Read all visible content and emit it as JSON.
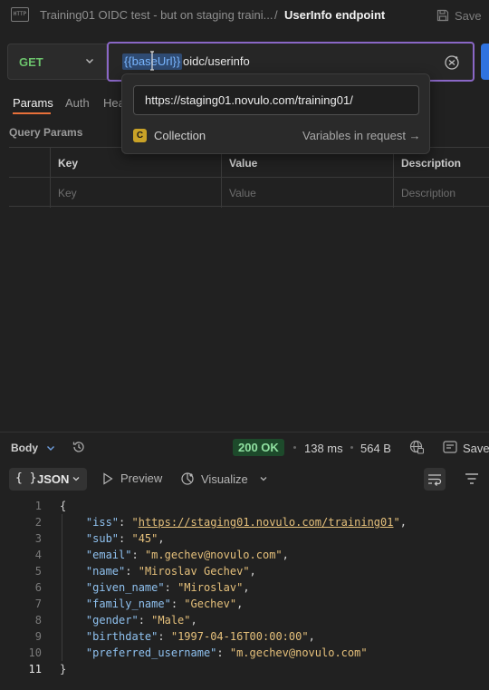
{
  "header": {
    "http_badge": "HTTP",
    "breadcrumb_parent": "Training01 OIDC test - but on staging traini...",
    "breadcrumb_separator": "/",
    "title": "UserInfo endpoint",
    "save_label": "Save"
  },
  "request": {
    "method": "GET",
    "url_variable": "{{baseUrl}}",
    "url_path": "oidc/userinfo"
  },
  "tabs": [
    {
      "label": "Params",
      "active": true
    },
    {
      "label": "Auth",
      "active": false
    },
    {
      "label": "Hea",
      "active": false
    }
  ],
  "query_params": {
    "title": "Query Params",
    "columns": [
      "Key",
      "Value",
      "Description"
    ],
    "placeholders": [
      "Key",
      "Value",
      "Description"
    ]
  },
  "variable_popover": {
    "value": "https://staging01.novulo.com/training01/",
    "scope_badge": "C",
    "scope_label": "Collection",
    "link_label": "Variables in request →"
  },
  "response": {
    "body_label": "Body",
    "status": "200 OK",
    "time": "138 ms",
    "size": "564 B",
    "save_label": "Save",
    "format": "JSON",
    "format_icon": "{ }",
    "preview_label": "Preview",
    "visualize_label": "Visualize",
    "active_line": 11,
    "code": {
      "open_brace": "{",
      "close_brace": "}",
      "fields": [
        {
          "key": "\"iss\"",
          "value": "\"https://staging01.novulo.com/training01\"",
          "is_link": true
        },
        {
          "key": "\"sub\"",
          "value": "\"45\""
        },
        {
          "key": "\"email\"",
          "value": "\"m.gechev@novulo.com\""
        },
        {
          "key": "\"name\"",
          "value": "\"Miroslav Gechev\""
        },
        {
          "key": "\"given_name\"",
          "value": "\"Miroslav\""
        },
        {
          "key": "\"family_name\"",
          "value": "\"Gechev\""
        },
        {
          "key": "\"gender\"",
          "value": "\"Male\""
        },
        {
          "key": "\"birthdate\"",
          "value": "\"1997-04-16T00:00:00\""
        },
        {
          "key": "\"preferred_username\"",
          "value": "\"m.gechev@novulo.com\""
        }
      ]
    }
  },
  "colors": {
    "accent_orange": "#e8703a",
    "method_green": "#6cc36c",
    "url_focus_purple": "#8a67c6",
    "variable_blue": "#79b6ff",
    "status_green": "#8fe0a0",
    "send_blue": "#2f73e0",
    "json_key": "#8fc1ef",
    "json_string": "#e5c07b"
  },
  "icons": {
    "method_chevron": "chevron-down-icon",
    "variable": "variable-icon",
    "history": "history-icon",
    "globe": "globe-icon",
    "save": "save-icon",
    "preview": "play-icon",
    "visualize": "visualize-icon",
    "wrap": "wrap-lines-icon",
    "filter": "filter-icon"
  }
}
